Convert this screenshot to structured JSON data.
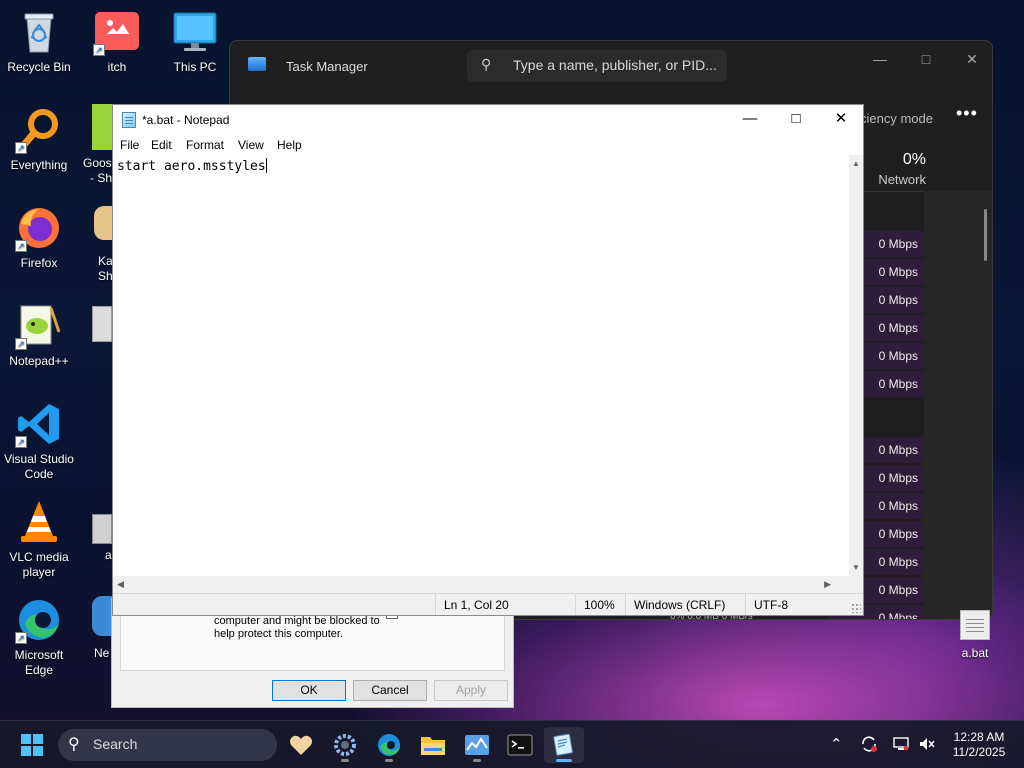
{
  "desktop": {
    "icons": [
      {
        "label": "Recycle Bin",
        "icon": "recycle-bin-icon"
      },
      {
        "label": "itch",
        "icon": "itch-icon"
      },
      {
        "label": "This PC",
        "icon": "this-pc-icon"
      },
      {
        "label": "Everything",
        "icon": "everything-search-icon"
      },
      {
        "label": "Firefox",
        "icon": "firefox-icon"
      },
      {
        "label": "Notepad++",
        "icon": "notepad-plus-plus-icon"
      },
      {
        "label": "Visual Studio Code",
        "icon": "vscode-icon"
      },
      {
        "label": "VLC media player",
        "icon": "vlc-icon"
      },
      {
        "label": "Microsoft Edge",
        "icon": "edge-icon"
      }
    ],
    "partial_labels": {
      "goose": "Goos",
      "goose2": "- Sh",
      "ka": "Ka",
      "ka2": "Sh",
      "a": "a",
      "ne": "Ne"
    },
    "bat_file": {
      "label": "a.bat",
      "icon": "bat-file-icon"
    }
  },
  "task_manager": {
    "title": "Task Manager",
    "search_placeholder": "Type a name, publisher, or PID...",
    "efficiency_label": "ciency mode",
    "network_percent": "0%",
    "network_label": "Network",
    "rows": [
      "0 Mbps",
      "0 Mbps",
      "0 Mbps",
      "0 Mbps",
      "0 Mbps",
      "0 Mbps",
      "0 Mbps",
      "0 Mbps",
      "0 Mbps",
      "0 Mbps",
      "0 Mbps",
      "0 Mbps",
      "0 Mbps"
    ],
    "partial_footer": "0%          0.0 MB          0 MB/s"
  },
  "properties_dialog": {
    "warning_line1": "computer and might be blocked to",
    "warning_line2": "help protect this computer.",
    "ok": "OK",
    "cancel": "Cancel",
    "apply": "Apply"
  },
  "notepad": {
    "title": "*a.bat - Notepad",
    "menu": [
      "File",
      "Edit",
      "Format",
      "View",
      "Help"
    ],
    "content": "start aero.msstyles",
    "status": {
      "position": "Ln 1, Col 20",
      "zoom": "100%",
      "line_ending": "Windows (CRLF)",
      "encoding": "UTF-8"
    }
  },
  "taskbar": {
    "search_label": "Search",
    "apps": [
      "start-icon",
      "widgets-icon",
      "settings-icon",
      "edge-icon",
      "file-explorer-icon",
      "task-manager-icon",
      "terminal-icon",
      "notepad-icon"
    ],
    "time": "12:28 AM",
    "date": "11/2/2025"
  },
  "colors": {
    "accent": "#5fb2ff",
    "tm_row": "#2e1d3a",
    "taskbar": "#16182a"
  }
}
